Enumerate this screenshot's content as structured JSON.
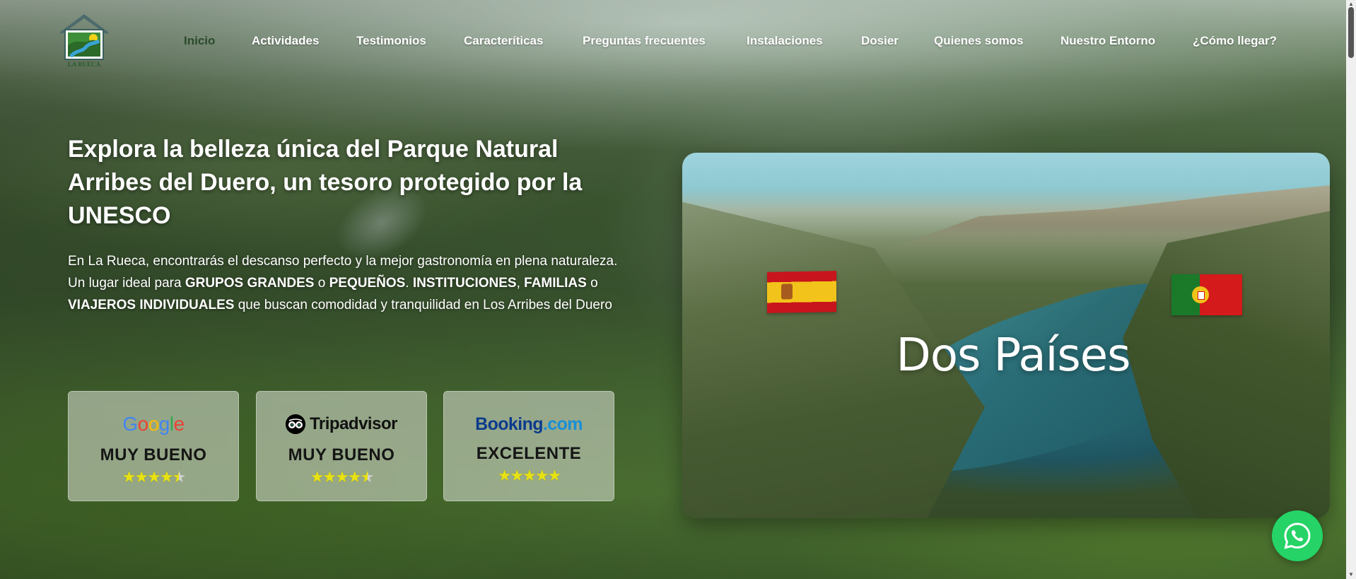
{
  "site": {
    "logo_text": "LA RUECA"
  },
  "nav": {
    "items": [
      {
        "label": "Inicio",
        "active": true
      },
      {
        "label": "Actividades"
      },
      {
        "label": "Testimonios"
      },
      {
        "label": "Caracteríticas"
      },
      {
        "label": "Preguntas frecuentes"
      },
      {
        "label": "Instalaciones"
      },
      {
        "label": "Dosier"
      },
      {
        "label": "Quienes somos"
      },
      {
        "label": "Nuestro Entorno"
      },
      {
        "label": "¿Cómo llegar?"
      }
    ]
  },
  "hero": {
    "title": "Explora la belleza única del Parque Natural Arribes del Duero, un tesoro protegido por la UNESCO",
    "desc_1": "En La Rueca, encontrarás el descanso perfecto y la mejor gastronomía en plena naturaleza. Un lugar ideal para ",
    "desc_b1": "GRUPOS GRANDES",
    "desc_2": " o ",
    "desc_b2": "PEQUEÑOS",
    "desc_3": ". ",
    "desc_b3": "INSTITUCIONES",
    "desc_4": ", ",
    "desc_b4": "FAMILIAS",
    "desc_5": " o ",
    "desc_b5": "VIAJEROS INDIVIDUALES",
    "desc_6": " que buscan comodidad y tranquilidad en Los Arribes del Duero"
  },
  "reviews": [
    {
      "brand": "Google",
      "icon": "google-logo",
      "rating_text": "MUY BUENO",
      "stars": 4.5
    },
    {
      "brand": "Tripadvisor",
      "icon": "tripadvisor-logo",
      "rating_text": "MUY BUENO",
      "stars": 4.5
    },
    {
      "brand": "Booking",
      "brand_suffix": ".com",
      "icon": "booking-logo",
      "rating_text": "EXCELENTE",
      "stars": 5
    }
  ],
  "video": {
    "title": "Dos Países",
    "flags": [
      "spain-flag",
      "portugal-flag"
    ]
  },
  "colors": {
    "nav_active": "#2b4a2c",
    "star": "#e8e213",
    "whatsapp": "#25d366",
    "booking_blue": "#0b3b8c"
  }
}
